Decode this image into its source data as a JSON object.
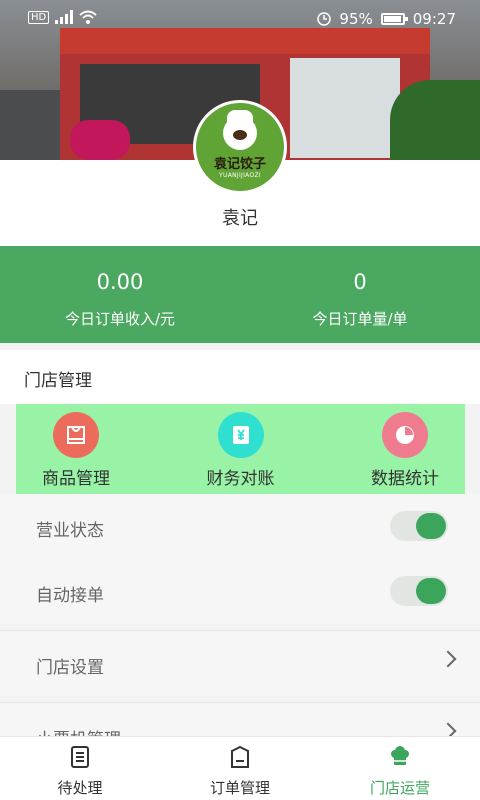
{
  "status_bar": {
    "hd": "HD",
    "battery": "95%",
    "time": "09:27"
  },
  "store": {
    "logo_cn": "袁记饺子",
    "logo_en": "YUANJIJIAOZI",
    "name": "袁记"
  },
  "stats": [
    {
      "value": "0.00",
      "label": "今日订单收入/元"
    },
    {
      "value": "0",
      "label": "今日订单量/单"
    }
  ],
  "section": {
    "title": "门店管理"
  },
  "quick_menu": [
    {
      "label": "商品管理",
      "icon": "shopping-bag-icon",
      "color": "#ec6b5b"
    },
    {
      "label": "财务对账",
      "icon": "yuan-icon",
      "color": "#2fe0d1"
    },
    {
      "label": "数据统计",
      "icon": "pie-chart-icon",
      "color": "#f07b8f"
    }
  ],
  "toggles": [
    {
      "label": "营业状态",
      "on": true
    },
    {
      "label": "自动接单",
      "on": true
    }
  ],
  "links": [
    {
      "label": "门店设置"
    },
    {
      "label": "小票机管理"
    }
  ],
  "bottom_nav": [
    {
      "label": "待处理",
      "icon": "list-icon",
      "active": false
    },
    {
      "label": "订单管理",
      "icon": "order-box-icon",
      "active": false
    },
    {
      "label": "门店运营",
      "icon": "chef-hat-icon",
      "active": true
    }
  ],
  "colors": {
    "primary_green": "#4aa860",
    "highlight": "#98f3a6",
    "active_green": "#3aa55b"
  }
}
